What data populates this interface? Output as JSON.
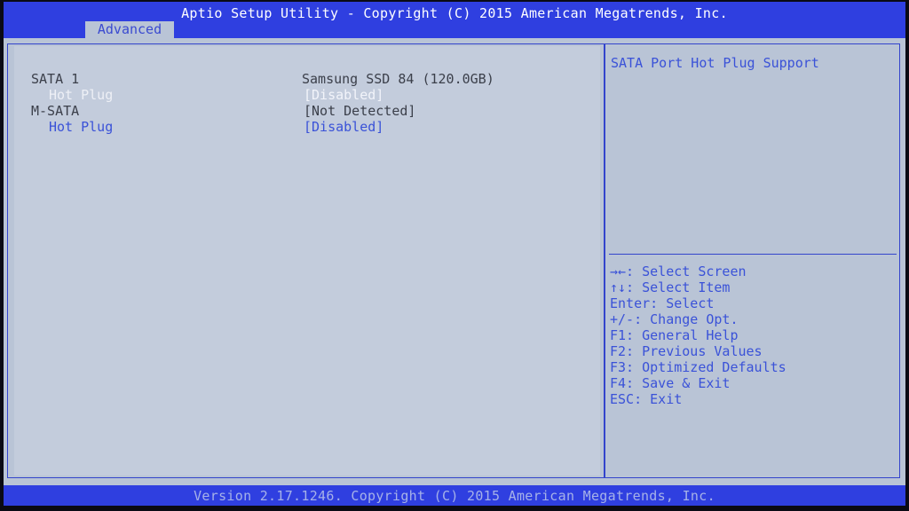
{
  "header": {
    "title": "Aptio Setup Utility - Copyright (C) 2015 American Megatrends, Inc.",
    "active_tab": "Advanced"
  },
  "settings": [
    {
      "label": "SATA 1",
      "value": "Samsung SSD 84 (120.0GB)"
    },
    {
      "label": "Hot Plug",
      "value": "[Disabled]"
    },
    {
      "label": "M-SATA",
      "value": "[Not Detected]"
    },
    {
      "label": "Hot Plug",
      "value": "[Disabled]"
    }
  ],
  "help": {
    "description": "SATA Port Hot Plug Support",
    "keys": [
      "→←: Select Screen",
      "↑↓: Select Item",
      "Enter: Select",
      "+/-: Change Opt.",
      "F1: General Help",
      "F2: Previous Values",
      "F3: Optimized Defaults",
      "F4: Save & Exit",
      "ESC: Exit"
    ]
  },
  "footer": {
    "version": "Version 2.17.1246. Copyright (C) 2015 American Megatrends, Inc."
  },
  "colors": {
    "header_bar": "#2f3fe0",
    "panel_bg": "#b9c4d6",
    "accent_text": "#3a52d8"
  }
}
